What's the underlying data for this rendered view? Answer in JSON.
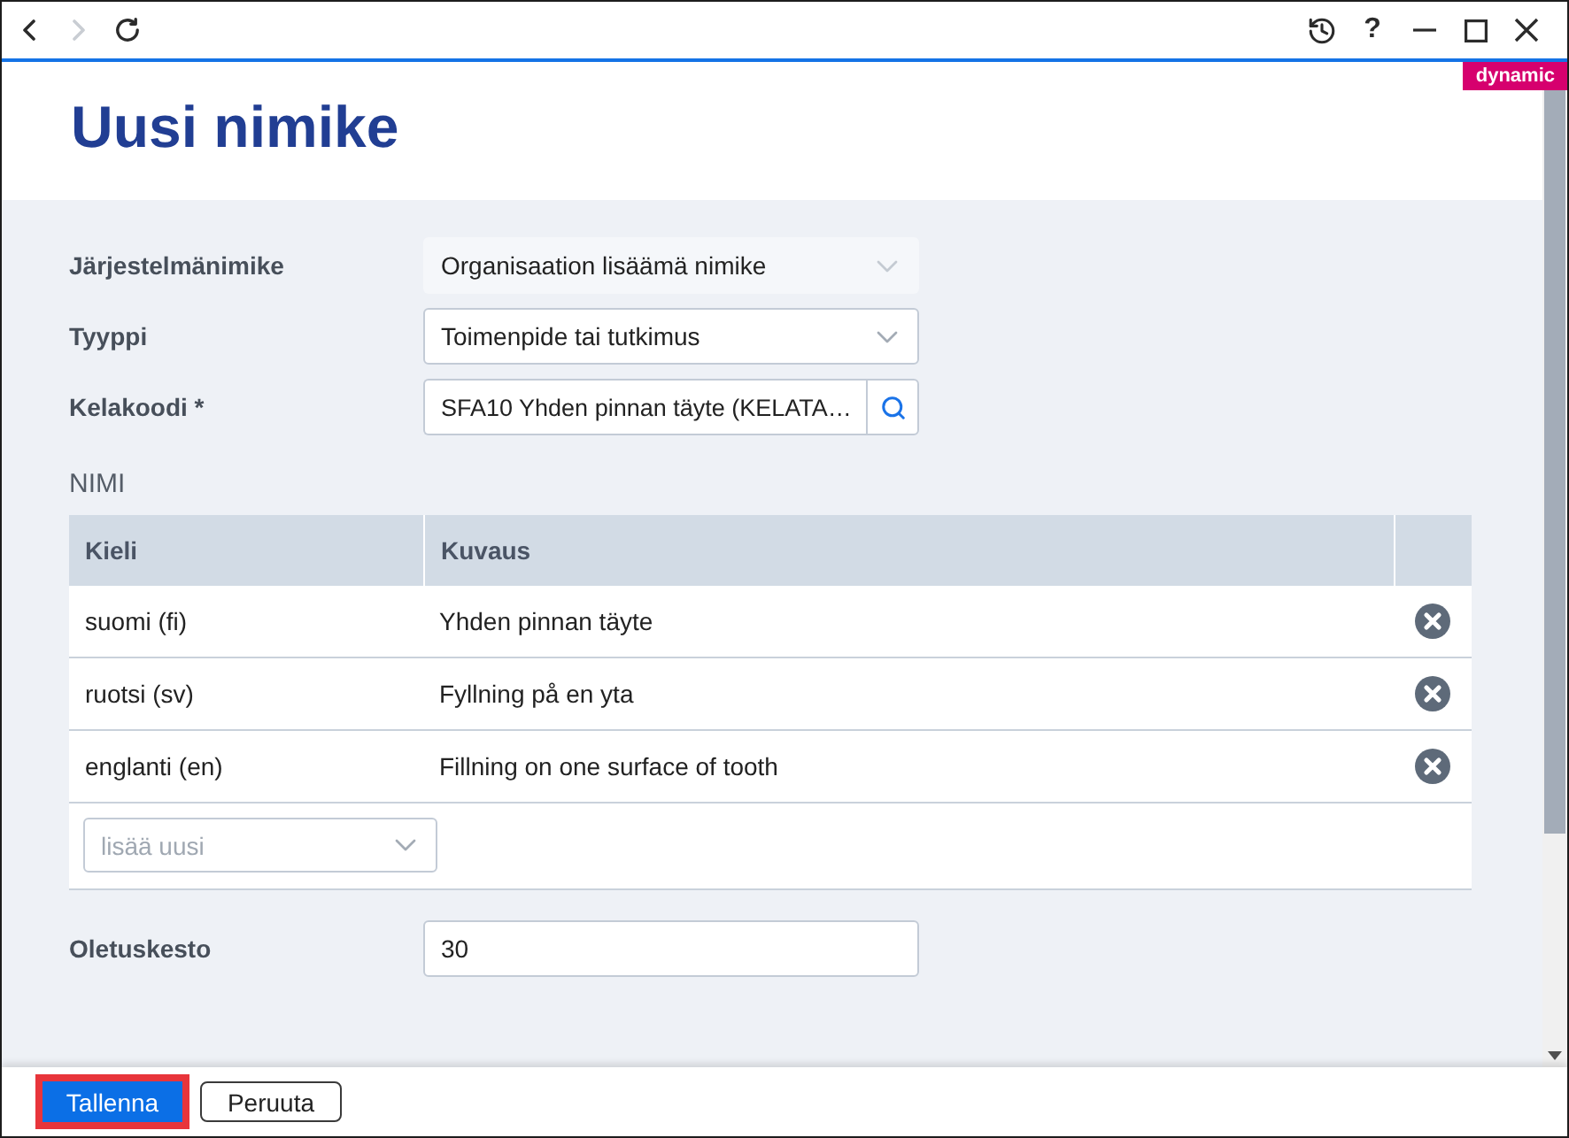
{
  "toolbar": {
    "nav": [
      {
        "kind": "back",
        "disabled": false
      },
      {
        "kind": "forward",
        "disabled": true
      },
      {
        "kind": "refresh",
        "disabled": false
      }
    ],
    "actions": [
      {
        "kind": "history"
      },
      {
        "kind": "help",
        "label": "?"
      },
      {
        "kind": "minimize"
      },
      {
        "kind": "maximize"
      },
      {
        "kind": "close"
      }
    ]
  },
  "badge": "dynamic",
  "title": "Uusi nimike",
  "fields": [
    {
      "label": "Järjestelmänimike",
      "kind": "select",
      "value": "Organisaation lisäämä nimike",
      "disabled": true
    },
    {
      "label": "Tyyppi",
      "kind": "select",
      "value": "Toimenpide tai tutkimus",
      "disabled": false
    },
    {
      "label": "Kelakoodi *",
      "kind": "search",
      "value": "SFA10 Yhden pinnan täyte (KELATA…"
    }
  ],
  "names": {
    "heading": "NIMI",
    "columns": [
      "Kieli",
      "Kuvaus"
    ],
    "rows": [
      {
        "language": "suomi (fi)",
        "description": "Yhden pinnan täyte"
      },
      {
        "language": "ruotsi (sv)",
        "description": "Fyllning på en yta"
      },
      {
        "language": "englanti (en)",
        "description": "Fillning on one surface of tooth"
      }
    ],
    "add_select": {
      "placeholder": "lisää uusi"
    }
  },
  "default_duration": {
    "label": "Oletuskesto",
    "kind": "text",
    "value": "30"
  },
  "footer": {
    "buttons": [
      {
        "label": "Tallenna",
        "kind": "primary",
        "focused": true
      },
      {
        "label": "Peruuta",
        "kind": "secondary",
        "focused": false
      }
    ]
  }
}
